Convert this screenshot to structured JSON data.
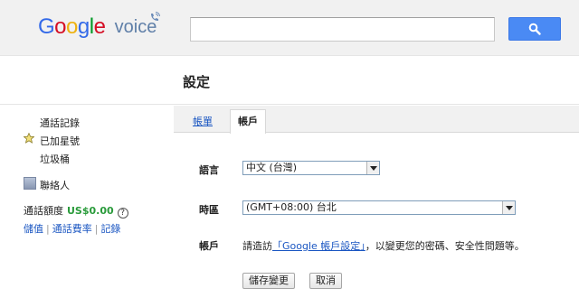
{
  "header": {
    "logo_letters": [
      {
        "ch": "G",
        "color": "#3369e8"
      },
      {
        "ch": "o",
        "color": "#d50f25"
      },
      {
        "ch": "o",
        "color": "#eeb211"
      },
      {
        "ch": "g",
        "color": "#3369e8"
      },
      {
        "ch": "l",
        "color": "#009925"
      },
      {
        "ch": "e",
        "color": "#d50f25"
      }
    ],
    "logo_product": "voice",
    "search": {
      "value": "",
      "placeholder": ""
    }
  },
  "page": {
    "title": "設定"
  },
  "sidebar": {
    "items": [
      {
        "label": "通話記錄"
      },
      {
        "label": "已加星號",
        "icon": "star-icon"
      },
      {
        "label": "垃圾桶"
      }
    ],
    "contacts_label": "聯絡人",
    "credit": {
      "label": "通話額度",
      "amount": "US$0.00"
    },
    "links": [
      "儲值",
      "通話費率",
      "記錄"
    ]
  },
  "tabs": {
    "general": "帳單",
    "account": "帳戶"
  },
  "form": {
    "language": {
      "label": "語言",
      "value": "中文 (台灣)"
    },
    "timezone": {
      "label": "時區",
      "value": "(GMT+08:00) 台北"
    },
    "account": {
      "label": "帳戶",
      "prefix": "請造訪",
      "link": "「Google 帳戶設定」",
      "suffix": "，以變更您的密碼、安全性問題等。"
    },
    "save_label": "儲存變更",
    "cancel_label": "取消"
  },
  "colors": {
    "accent": "#4a8af4",
    "link": "#1a56c2",
    "credit": "#2a9b3b"
  }
}
